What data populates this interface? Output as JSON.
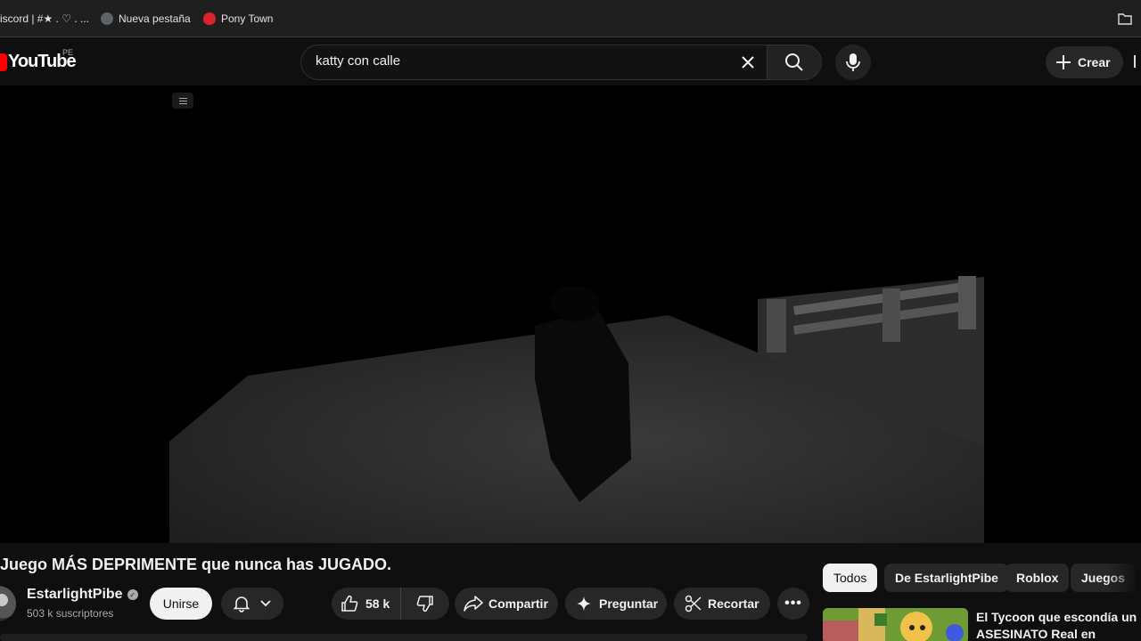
{
  "bookmarks": {
    "items": [
      {
        "label": "iscord | #★ . ♡ . ..."
      },
      {
        "label": "Nueva pestaña"
      },
      {
        "label": "Pony Town"
      }
    ]
  },
  "header": {
    "logo_text": "YouTube",
    "country": "PE",
    "search_value": "katty con calle",
    "create_label": "Crear"
  },
  "video": {
    "title": "Juego MÁS DEPRIMENTE que nunca has JUGADO.",
    "channel": "EstarlightPibe",
    "subscribers": "503 k suscriptores",
    "join_label": "Unirse",
    "likes": "58 k",
    "share_label": "Compartir",
    "ask_label": "Preguntar",
    "clip_label": "Recortar"
  },
  "chips": [
    "Todos",
    "De EstarlightPibe",
    "Roblox",
    "Juegos"
  ],
  "recommended": {
    "title": "El Tycoon que escondía un ASESINATO Real en Roblox"
  }
}
